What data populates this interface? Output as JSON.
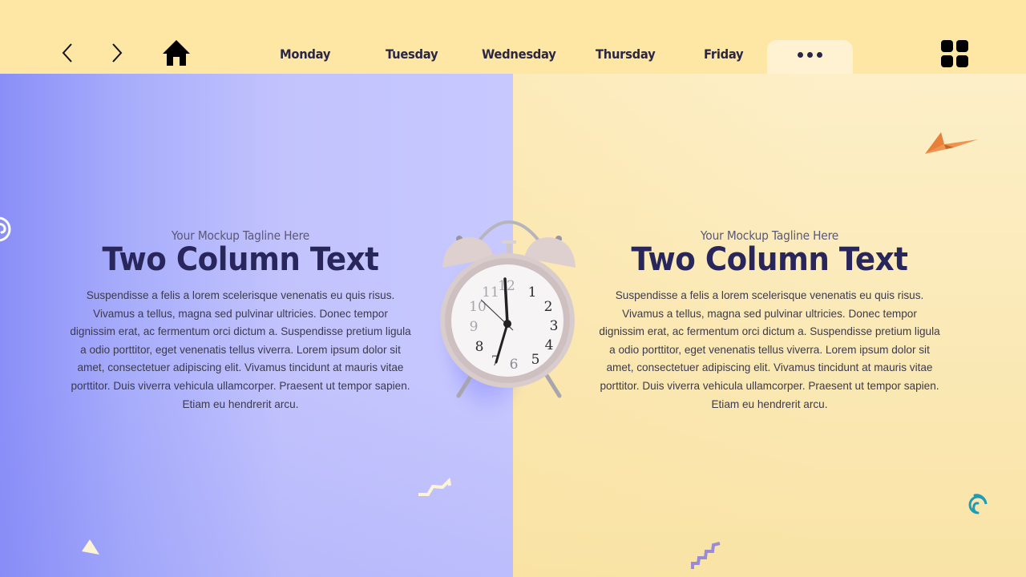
{
  "nav": {
    "back_icon": "chevron-left-icon",
    "forward_icon": "chevron-right-icon",
    "home_icon": "home-icon",
    "tabs": [
      {
        "label": "Monday"
      },
      {
        "label": "Tuesday"
      },
      {
        "label": "Wednesday"
      },
      {
        "label": "Thursday"
      },
      {
        "label": "Friday"
      }
    ],
    "more_icon": "more-horizontal-icon",
    "apps_icon": "grid-icon"
  },
  "columns": [
    {
      "tagline": "Your Mockup Tagline Here",
      "title": "Two Column Text",
      "body": "Suspendisse a felis a lorem scelerisque venenatis eu quis risus. Vivamus a tellus, magna sed pulvinar ultricies. Donec tempor dignissim erat, ac fermentum orci dictum a. Suspendisse pretium ligula a odio porttitor, eget venenatis tellus viverra. Lorem ipsum dolor sit amet, consectetuer adipiscing elit. Vivamus tincidunt at mauris vitae porttitor. Duis viverra vehicula ullamcorper. Praesent ut tempor sapien. Etiam eu hendrerit arcu."
    },
    {
      "tagline": "Your Mockup Tagline Here",
      "title": "Two Column Text",
      "body": "Suspendisse a felis a lorem scelerisque venenatis eu quis risus. Vivamus a tellus, magna sed pulvinar ultricies. Donec tempor dignissim erat, ac fermentum orci dictum a. Suspendisse pretium ligula a odio porttitor, eget venenatis tellus viverra. Lorem ipsum dolor sit amet, consectetuer adipiscing elit. Vivamus tincidunt at mauris vitae porttitor. Duis viverra vehicula ullamcorper. Praesent ut tempor sapien. Etiam eu hendrerit arcu."
    }
  ],
  "clock": {
    "numerals": [
      "12",
      "1",
      "2",
      "3",
      "4",
      "5",
      "6",
      "7",
      "8",
      "9",
      "10",
      "11"
    ],
    "time_shown": "6:35"
  },
  "colors": {
    "topbar": "#fee6a4",
    "left_panel": "#c2c3fd",
    "right_panel": "#fbeab9",
    "title": "#28265a",
    "paper_plane": "#e8803a",
    "spiral": "#1e9bb5"
  }
}
